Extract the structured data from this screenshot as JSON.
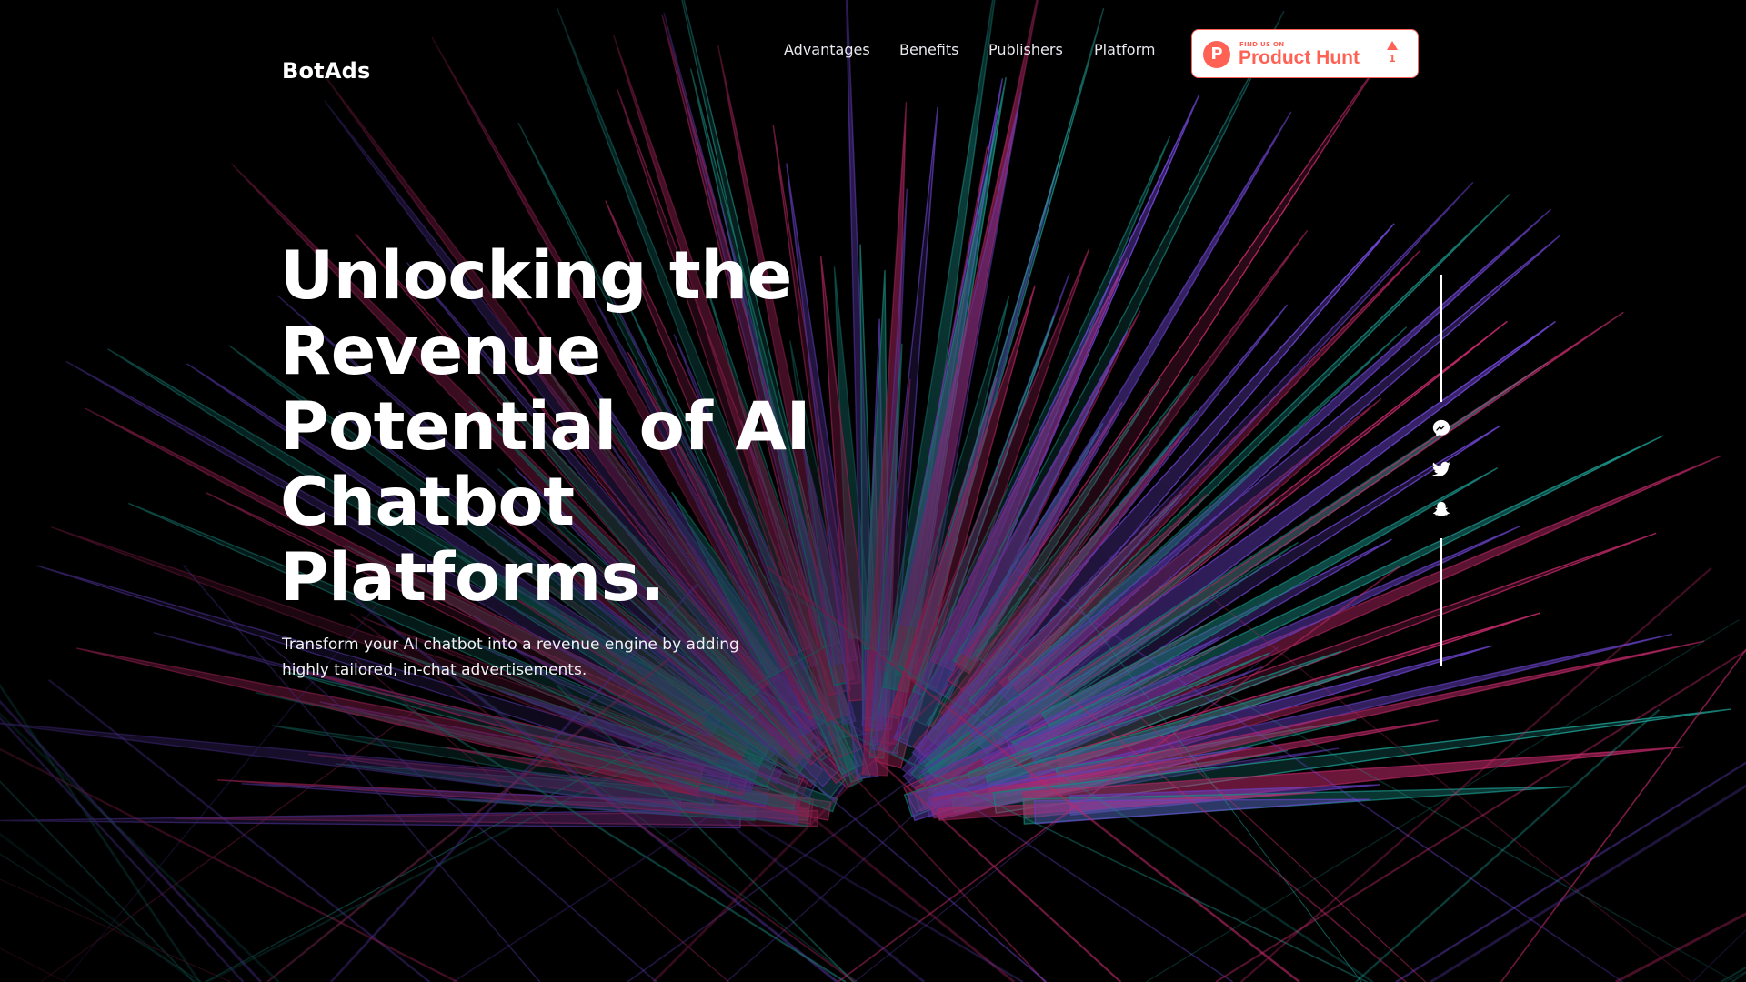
{
  "brand": {
    "logo": "BotAds"
  },
  "nav": {
    "links": [
      {
        "label": "Advantages"
      },
      {
        "label": "Benefits"
      },
      {
        "label": "Publishers"
      },
      {
        "label": "Platform"
      }
    ]
  },
  "product_hunt_badge": {
    "logo_letter": "P",
    "find_us": "FIND US ON",
    "name": "Product Hunt",
    "upvotes": "1",
    "color": "#ff6154"
  },
  "hero": {
    "headline_lines": [
      "Unlocking the",
      "Revenue",
      "Potential of AI",
      "Chatbot",
      "Platforms."
    ],
    "subhead_lines": [
      "Transform your AI chatbot into a revenue engine by adding",
      "highly tailored, in-chat advertisements."
    ]
  },
  "social": {
    "icons": [
      "messenger-icon",
      "twitter-icon",
      "snapchat-icon"
    ]
  },
  "colors": {
    "background": "#000000",
    "spike_pink": "#e0307a",
    "spike_purple": "#7a4ce8",
    "spike_teal": "#1fa59a"
  }
}
